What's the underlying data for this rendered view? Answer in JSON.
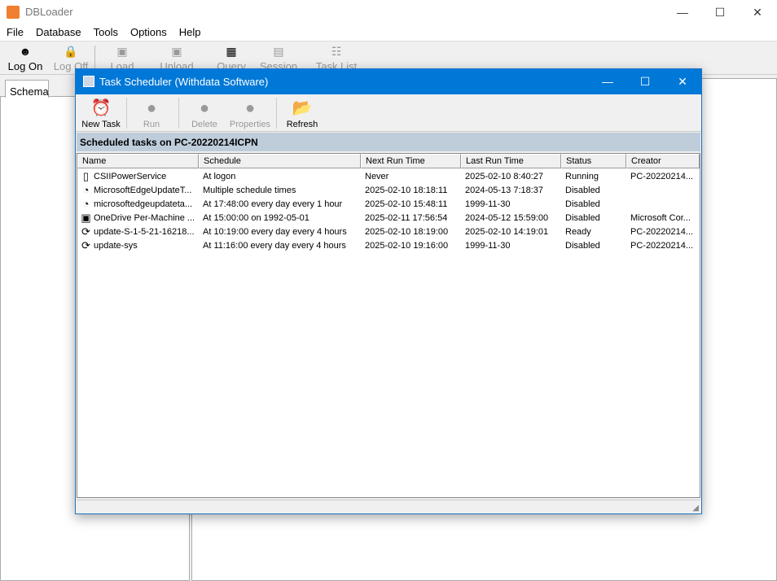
{
  "app": {
    "title": "DBLoader",
    "minimize": "—",
    "maximize": "☐",
    "close": "✕"
  },
  "menu": [
    "File",
    "Database",
    "Tools",
    "Options",
    "Help"
  ],
  "toolbar": [
    {
      "label": "Log On",
      "icon": "user-icon"
    },
    {
      "label": "Log Off",
      "icon": "lock-icon"
    },
    {
      "label": "Load",
      "icon": "load-icon"
    },
    {
      "label": "Unload",
      "icon": "unload-icon"
    },
    {
      "label": "Query",
      "icon": "query-icon"
    },
    {
      "label": "Session",
      "icon": "session-icon"
    },
    {
      "label": "Task List",
      "icon": "task-list-icon"
    }
  ],
  "left_tab": "Schema",
  "dialog": {
    "title": "Task Scheduler (Withdata Software)",
    "toolbar": [
      {
        "label": "New Task",
        "enabled": true
      },
      {
        "label": "Run",
        "enabled": false
      },
      {
        "label": "Delete",
        "enabled": false
      },
      {
        "label": "Properties",
        "enabled": false
      },
      {
        "label": "Refresh",
        "enabled": true
      }
    ],
    "band": "Scheduled tasks on PC-20220214ICPN",
    "columns": [
      "Name",
      "Schedule",
      "Next Run Time",
      "Last Run Time",
      "Status",
      "Creator"
    ],
    "rows": [
      {
        "icon": "document-icon",
        "name": "CSIIPowerService",
        "schedule": "At logon",
        "next": "Never",
        "last": "2025-02-10 8:40:27",
        "status": "Running",
        "creator": "PC-20220214..."
      },
      {
        "icon": "task-icon",
        "name": "MicrosoftEdgeUpdateT...",
        "schedule": "Multiple schedule times",
        "next": "2025-02-10 18:18:11",
        "last": "2024-05-13 7:18:37",
        "status": "Disabled",
        "creator": ""
      },
      {
        "icon": "task-icon",
        "name": "microsoftedgeupdateta...",
        "schedule": "At 17:48:00 every day every 1 hour",
        "next": "2025-02-10 15:48:11",
        "last": "1999-11-30",
        "status": "Disabled",
        "creator": ""
      },
      {
        "icon": "window-icon",
        "name": "OneDrive Per-Machine ...",
        "schedule": "At 15:00:00 on 1992-05-01",
        "next": "2025-02-11 17:56:54",
        "last": "2024-05-12 15:59:00",
        "status": "Disabled",
        "creator": "Microsoft Cor..."
      },
      {
        "icon": "refresh-icon",
        "name": "update-S-1-5-21-16218...",
        "schedule": "At 10:19:00 every day every 4 hours",
        "next": "2025-02-10 18:19:00",
        "last": "2025-02-10 14:19:01",
        "status": "Ready",
        "creator": "PC-20220214..."
      },
      {
        "icon": "refresh-icon",
        "name": "update-sys",
        "schedule": "At 11:16:00 every day every 4 hours",
        "next": "2025-02-10 19:16:00",
        "last": "1999-11-30",
        "status": "Disabled",
        "creator": "PC-20220214..."
      }
    ]
  }
}
